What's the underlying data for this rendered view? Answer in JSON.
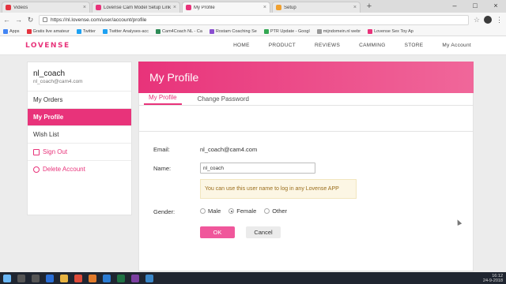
{
  "browser": {
    "tabs": [
      {
        "label": "Videos",
        "color": "#e4343f",
        "active": false
      },
      {
        "label": "Lovense Cam Model Setup Link",
        "color": "#e8337a",
        "active": false
      },
      {
        "label": "My Profile",
        "color": "#e8337a",
        "active": true
      },
      {
        "label": "Setup",
        "color": "#f0a030",
        "active": false
      }
    ],
    "url": "https://nl.lovense.com/user/account/profile",
    "bookmarks": [
      {
        "label": "Apps",
        "color": "#4285f4"
      },
      {
        "label": "Gratis live amateur",
        "color": "#e4343f"
      },
      {
        "label": "Twitter",
        "color": "#1da1f2"
      },
      {
        "label": "Twitter Analyses-acc",
        "color": "#1da1f2"
      },
      {
        "label": "Cam4Coach NL - Ca",
        "color": "#2e8b57"
      },
      {
        "label": "Rostam Coaching Se",
        "color": "#8a4fd0"
      },
      {
        "label": "PTR Update - Googl",
        "color": "#34a853"
      },
      {
        "label": "mijndomein.nl webr",
        "color": "#999999"
      },
      {
        "label": "Lovense Sex Toy Ap",
        "color": "#e8337a"
      }
    ]
  },
  "site": {
    "logo": "LOVENSE",
    "accent": "#e8337a",
    "menu": [
      "HOME",
      "PRODUCT",
      "REVIEWS",
      "CAMMING",
      "STORE",
      "My Account"
    ]
  },
  "sidebar": {
    "username": "nl_coach",
    "email": "nl_coach@cam4.com",
    "items": [
      {
        "label": "My Orders"
      },
      {
        "label": "My Profile"
      },
      {
        "label": "Wish List"
      },
      {
        "label": "Sign Out"
      },
      {
        "label": "Delete Account"
      }
    ]
  },
  "main": {
    "title": "My Profile",
    "tabs": [
      "My Profile",
      "Change Password"
    ],
    "email_label": "Email:",
    "email_value": "nl_coach@cam4.com",
    "name_label": "Name:",
    "name_value": "nl_coach",
    "hint": "You can use this user name to log in any Lovense APP",
    "gender_label": "Gender:",
    "gender_options": [
      "Male",
      "Female",
      "Other"
    ],
    "gender_selected": "Female",
    "ok_label": "OK",
    "cancel_label": "Cancel"
  },
  "taskbar": {
    "time": "16:12",
    "date": "24-9-2018"
  }
}
